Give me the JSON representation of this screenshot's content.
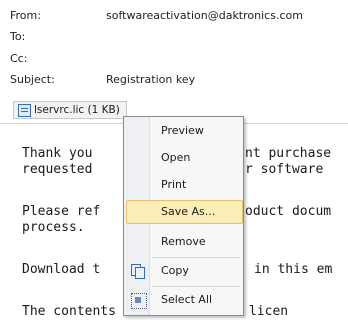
{
  "header": {
    "from_label": "From:",
    "from_value": "softwareactivation@daktronics.com",
    "to_label": "To:",
    "cc_label": "Cc:",
    "subject_label": "Subject:",
    "subject_value": "Registration key"
  },
  "attachment": {
    "name": "lservrc.lic (1 KB)",
    "icon": "attachment-file-icon"
  },
  "body_lines": [
    "Thank you",
    "requested",
    "Please ref",
    "process.",
    "Download t",
    "The contents of the attached licen"
  ],
  "body_right_fragments": [
    "nt purchase",
    "r software",
    "oduct docum",
    "in this em"
  ],
  "context_menu": {
    "items": [
      {
        "label": "Preview",
        "icon": ""
      },
      {
        "label": "Open",
        "icon": ""
      },
      {
        "label": "Print",
        "icon": ""
      },
      {
        "label": "Save As...",
        "icon": "",
        "highlighted": true
      },
      {
        "label": "Remove",
        "icon": ""
      },
      {
        "label": "Copy",
        "icon": "copy-icon"
      },
      {
        "label": "Select All",
        "icon": "select-all-icon"
      }
    ]
  },
  "colors": {
    "menu_highlight": "#fdeeb9",
    "menu_highlight_border": "#e3c46b",
    "menu_background": "#f7f7f7"
  }
}
